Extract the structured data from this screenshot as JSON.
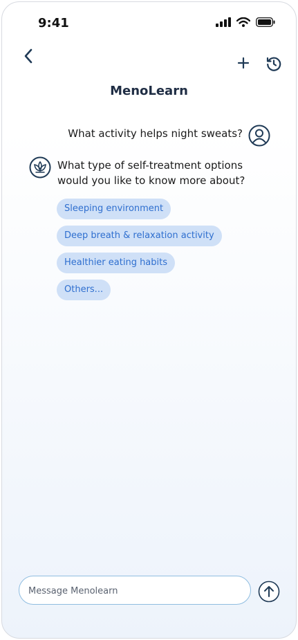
{
  "status_bar": {
    "time": "9:41",
    "icons": [
      "signal-icon",
      "wifi-icon",
      "battery-icon"
    ]
  },
  "header": {
    "title": "MenoLearn",
    "icons": [
      "back-chevron-icon",
      "plus-icon",
      "history-icon"
    ]
  },
  "conversation": {
    "user_message": "What activity helps night sweats?",
    "bot_message": "What type of self-treatment options would you like to know more about?",
    "options": [
      "Sleeping environment",
      "Deep breath & relaxation activity",
      "Healthier eating habits",
      "Others..."
    ]
  },
  "composer": {
    "placeholder": "Message Menolearn",
    "value": ""
  },
  "colors": {
    "accent": "#2f6fcf",
    "chip_background": "#cfe0f7",
    "icon_dark": "#1f3a56",
    "title": "#1f2d44"
  }
}
